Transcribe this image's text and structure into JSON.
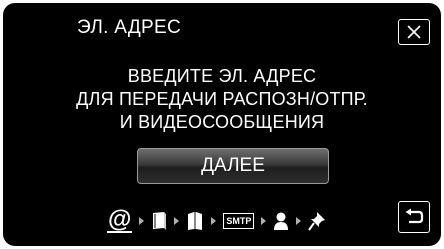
{
  "header": {
    "title": "ЭЛ. АДРЕС",
    "close_icon": "close-icon"
  },
  "message": {
    "lines": [
      "ВВЕДИТЕ ЭЛ. АДРЕС",
      "ДЛЯ ПЕРЕДАЧИ РАСПОЗН/ОТПР.",
      "И ВИДЕОСООБЩЕНИЯ"
    ]
  },
  "next_button": {
    "label": "ДАЛЕЕ"
  },
  "steps": {
    "items": [
      {
        "icon": "at-sign-icon",
        "label": "@",
        "active": true
      },
      {
        "icon": "book-icon",
        "active": false
      },
      {
        "icon": "open-book-icon",
        "active": false
      },
      {
        "icon": "smtp-icon",
        "label": "SMTP",
        "active": false
      },
      {
        "icon": "user-icon",
        "active": false
      },
      {
        "icon": "pin-icon",
        "active": false
      }
    ]
  },
  "footer": {
    "return_icon": "return-icon"
  },
  "colors": {
    "background": "#000000",
    "text": "#ffffff",
    "button_border": "#9a9a9a"
  }
}
